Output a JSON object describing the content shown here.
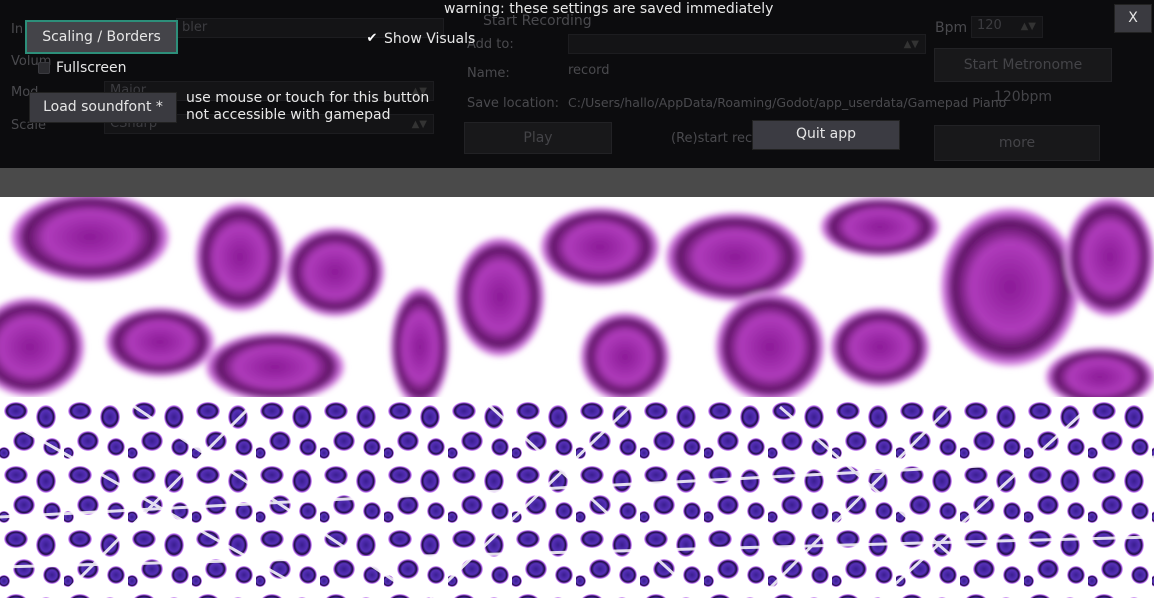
{
  "warning": "warning: these settings are saved immediately",
  "close_label": "X",
  "settings": {
    "scaling_label": "Scaling / Borders",
    "fullscreen_label": "Fullscreen",
    "fullscreen_checked": false,
    "show_visuals_label": "Show Visuals",
    "show_visuals_checked": true,
    "show_visuals_mark": "✔",
    "load_soundfont_label": "Load soundfont *",
    "soundfont_note_line1": "use mouse or touch for this button",
    "soundfont_note_line2": "not accessible with gamepad",
    "quit_label": "Quit app"
  },
  "background_panel": {
    "instrument_label": "In",
    "instrument_value": "bler",
    "volume_label": "Volum",
    "mode_label": "Mod",
    "mode_value": "Major",
    "scale_label": "Scale",
    "scale_value": "CSharp",
    "start_recording_label": "Start Recording",
    "add_to_label": "Add to:",
    "name_label": "Name:",
    "name_value": "record",
    "save_location_label": "Save location:",
    "save_location_value": "C:/Users/hallo/AppData/Roaming/Godot/app_userdata/Gamepad Piano",
    "play_label": "Play",
    "restart_record_label": "(Re)start reco",
    "bpm_label": "Bpm",
    "bpm_value": "120",
    "metronome_label": "Start Metronome 120bpm",
    "more_label": "more"
  },
  "colors": {
    "accent_border": "#2d8f7a",
    "button_bg": "#3a3a40",
    "visual_top": "#b030b8",
    "visual_bottom": "#4a2aa0"
  }
}
